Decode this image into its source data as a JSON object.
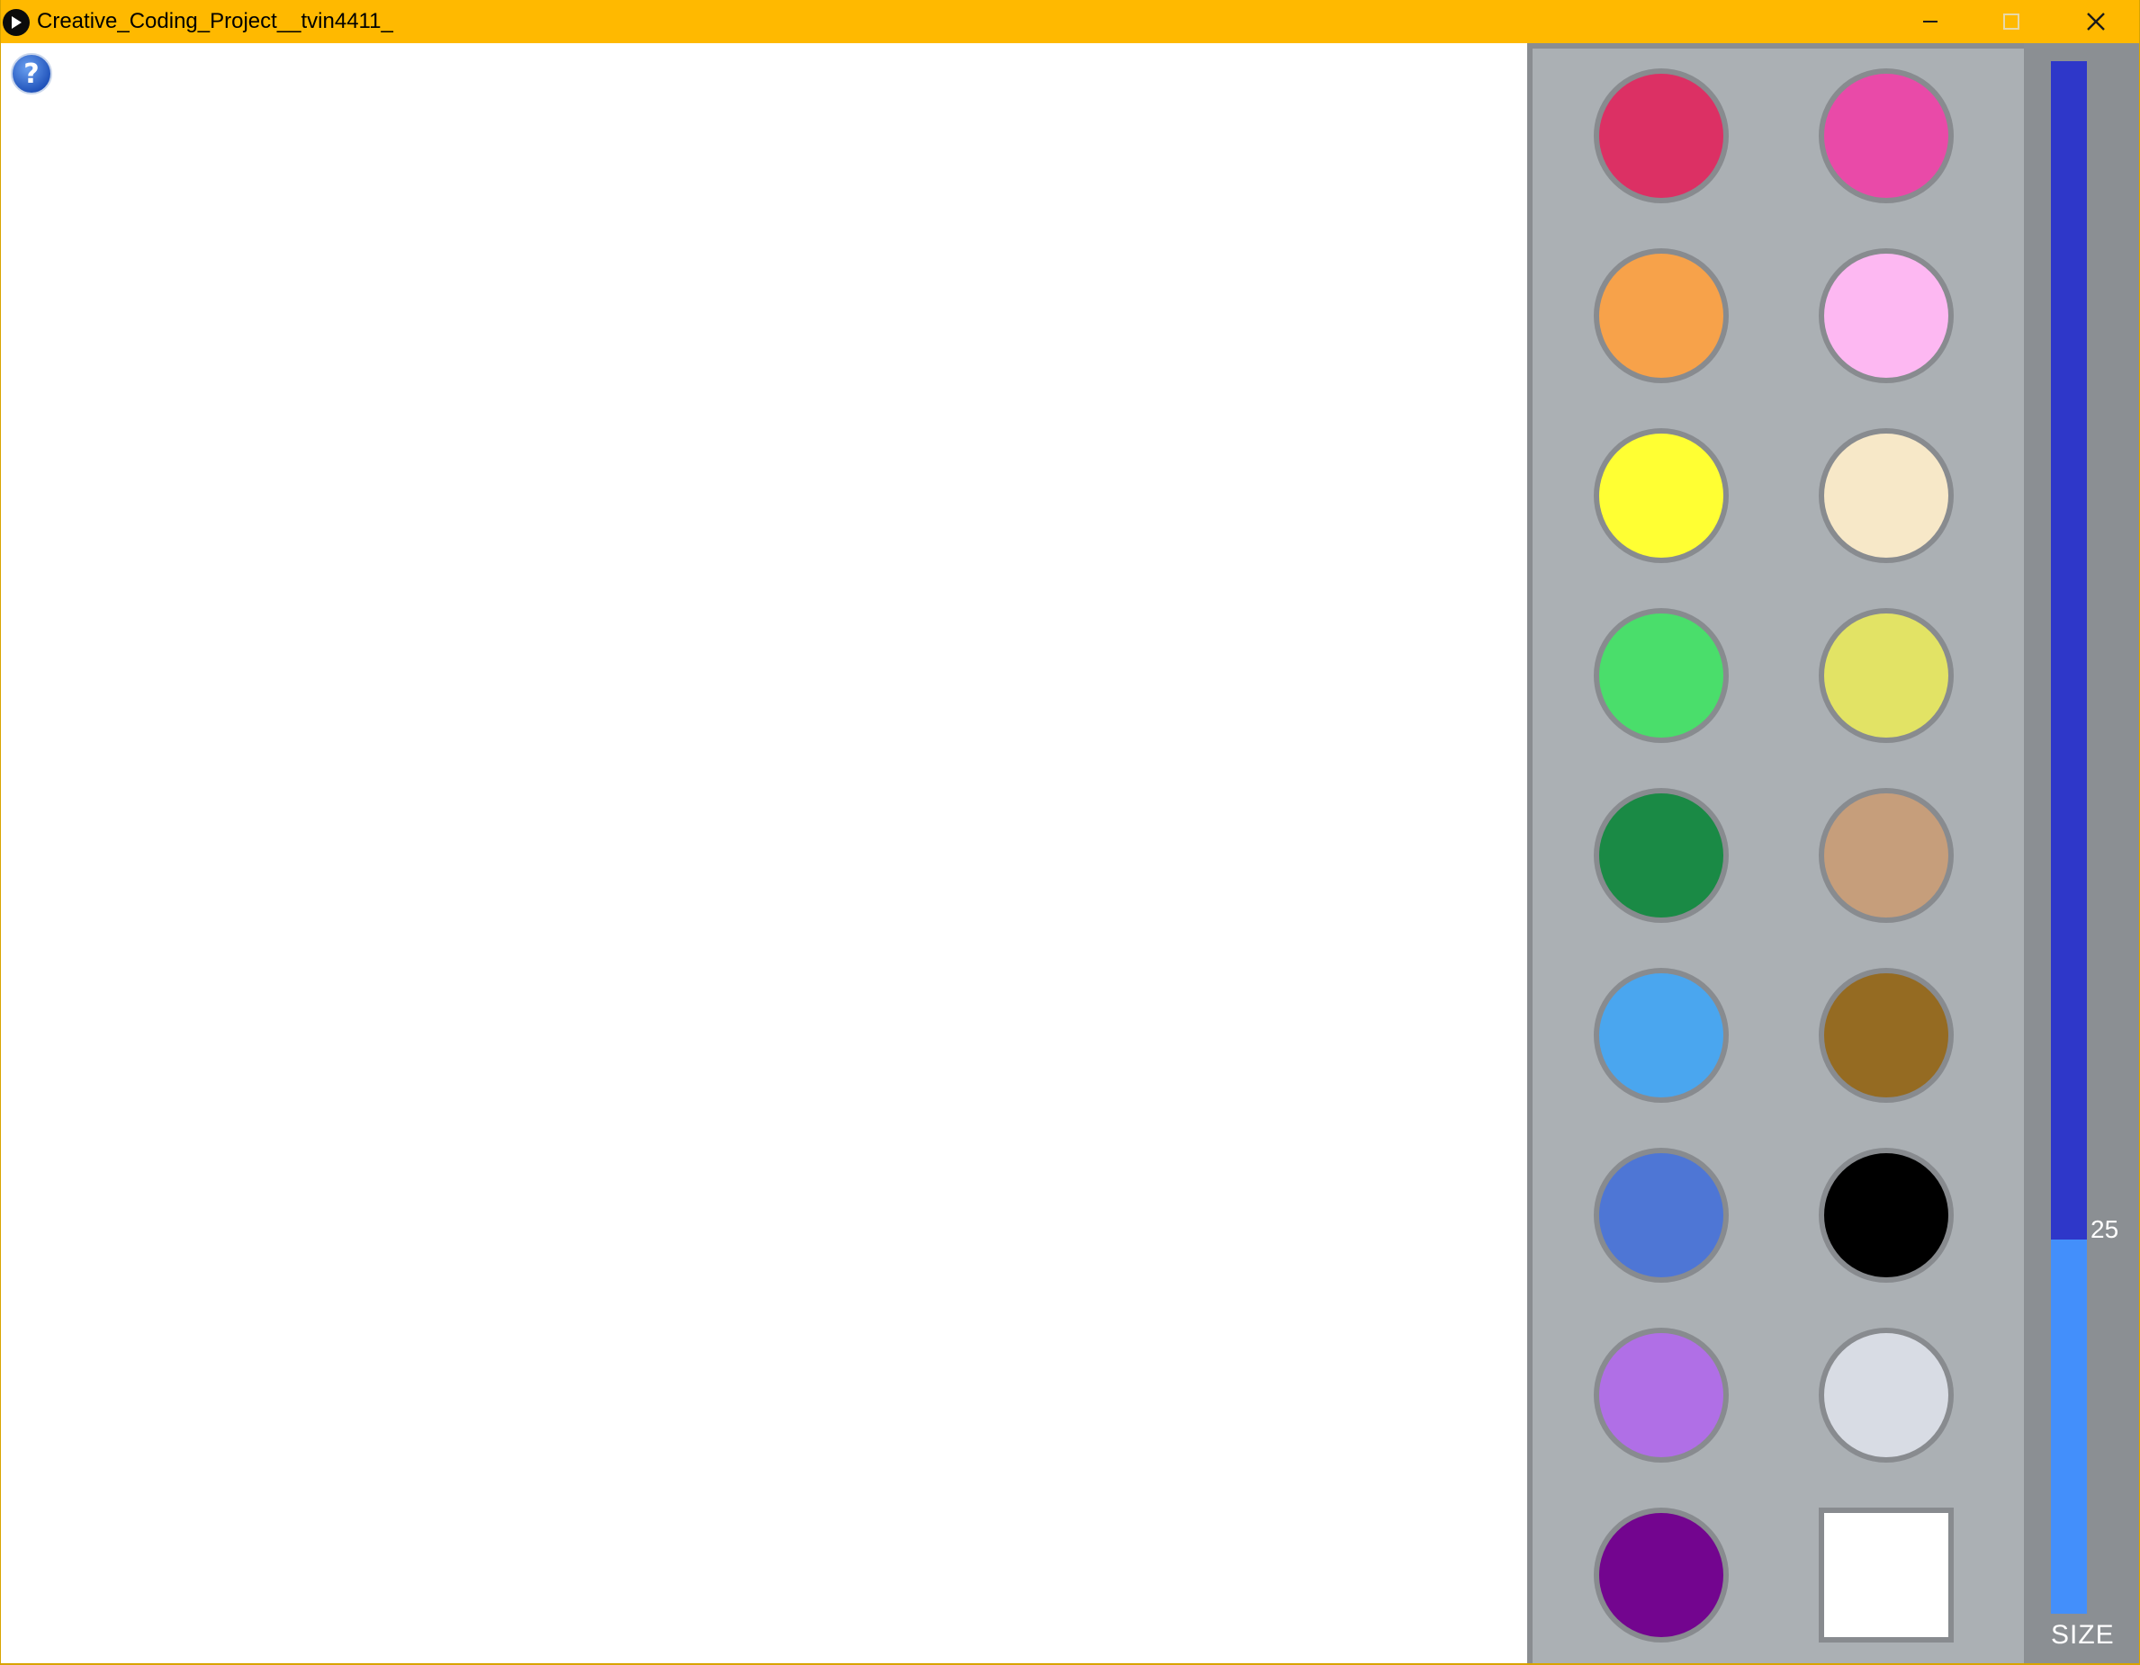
{
  "window": {
    "title": "Creative_Coding_Project__tvin4411_",
    "titlebar_color": "#ffb900",
    "icon": "processing-play-icon",
    "controls": {
      "minimize_icon": "minimize-icon",
      "maximize_icon": "maximize-icon",
      "close_icon": "close-icon"
    }
  },
  "canvas": {
    "background": "#ffffff",
    "help_icon": "help-question-icon"
  },
  "palette": {
    "background": "#abb0b4",
    "swatches": [
      {
        "name": "crimson",
        "color": "#dc3064",
        "shape": "circle"
      },
      {
        "name": "hot-pink",
        "color": "#e94aa8",
        "shape": "circle"
      },
      {
        "name": "orange",
        "color": "#f7a24a",
        "shape": "circle"
      },
      {
        "name": "light-pink",
        "color": "#fdb8f2",
        "shape": "circle"
      },
      {
        "name": "yellow",
        "color": "#ffff33",
        "shape": "circle"
      },
      {
        "name": "cream",
        "color": "#f7e8c8",
        "shape": "circle"
      },
      {
        "name": "light-green",
        "color": "#4ade6b",
        "shape": "circle"
      },
      {
        "name": "khaki-yellow",
        "color": "#e2e365",
        "shape": "circle"
      },
      {
        "name": "dark-green",
        "color": "#1a8a45",
        "shape": "circle"
      },
      {
        "name": "tan",
        "color": "#c69e7b",
        "shape": "circle"
      },
      {
        "name": "sky-blue",
        "color": "#4aa6ef",
        "shape": "circle"
      },
      {
        "name": "brown",
        "color": "#956b22",
        "shape": "circle"
      },
      {
        "name": "royal-blue",
        "color": "#4e76d5",
        "shape": "circle"
      },
      {
        "name": "black",
        "color": "#000000",
        "shape": "circle"
      },
      {
        "name": "lavender",
        "color": "#b06fe6",
        "shape": "circle"
      },
      {
        "name": "light-gray",
        "color": "#d8dce4",
        "shape": "circle"
      },
      {
        "name": "purple",
        "color": "#73058f",
        "shape": "circle"
      },
      {
        "name": "eraser-white",
        "color": "#ffffff",
        "shape": "square"
      }
    ]
  },
  "size_slider": {
    "value": "25",
    "label": "SIZE",
    "fill_fraction": 0.241,
    "track_color": "#2e37c9",
    "fill_color": "#438ffb"
  }
}
